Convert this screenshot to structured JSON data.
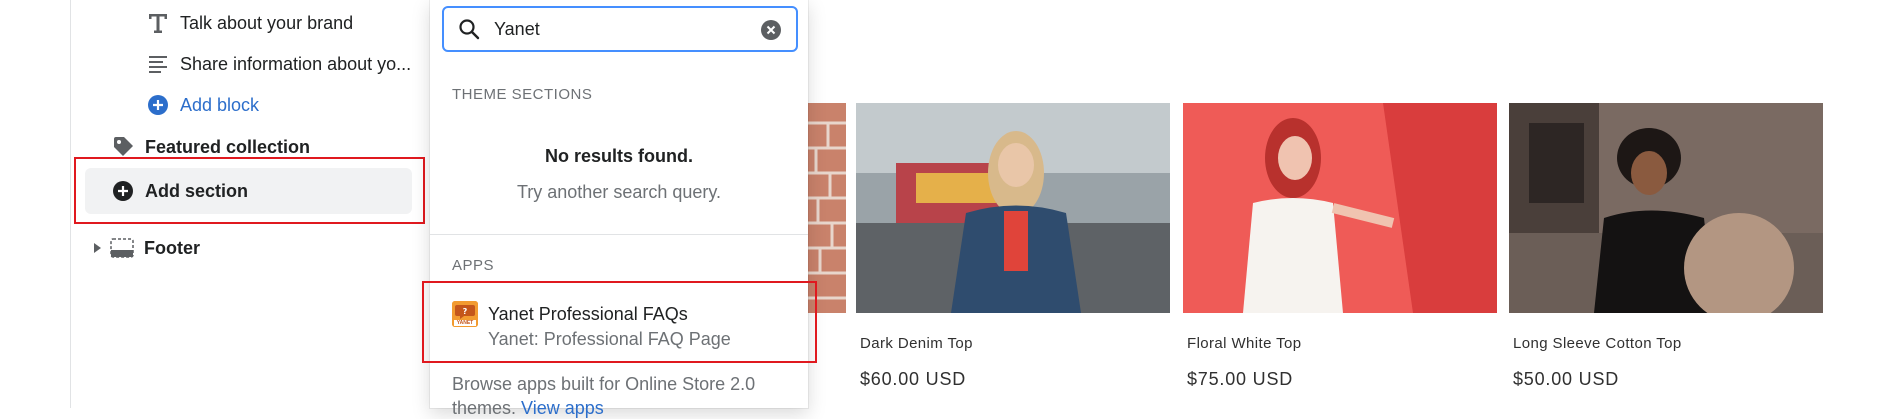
{
  "sidebar": {
    "blocks": [
      {
        "icon": "text-icon",
        "label": "Talk about your brand"
      },
      {
        "icon": "paragraph-icon",
        "label": "Share information about yo..."
      }
    ],
    "add_block_label": "Add block",
    "featured_collection_label": "Featured collection",
    "add_section_label": "Add section",
    "footer_label": "Footer"
  },
  "search": {
    "value": "Yanet",
    "theme_sections_header": "THEME SECTIONS",
    "no_results": "No results found.",
    "try_another": "Try another search query.",
    "apps_header": "APPS",
    "app": {
      "icon_text": "YANET",
      "title": "Yanet Professional FAQs",
      "subtitle": "Yanet: Professional FAQ Page"
    },
    "browse_text": "Browse apps built for Online Store 2.0",
    "browse_text_2": "themes.",
    "view_apps_link": "View apps"
  },
  "products": [
    {
      "name": "Dark Denim Top",
      "price": "$60.00 USD"
    },
    {
      "name": "Floral White Top",
      "price": "$75.00 USD"
    },
    {
      "name": "Long Sleeve Cotton Top",
      "price": "$50.00 USD"
    }
  ],
  "colors": {
    "accent_blue": "#2c6ecb",
    "focus_blue": "#458fff",
    "highlight_red": "#e0191f",
    "text_dark": "#202223",
    "text_muted": "#6d7175"
  }
}
